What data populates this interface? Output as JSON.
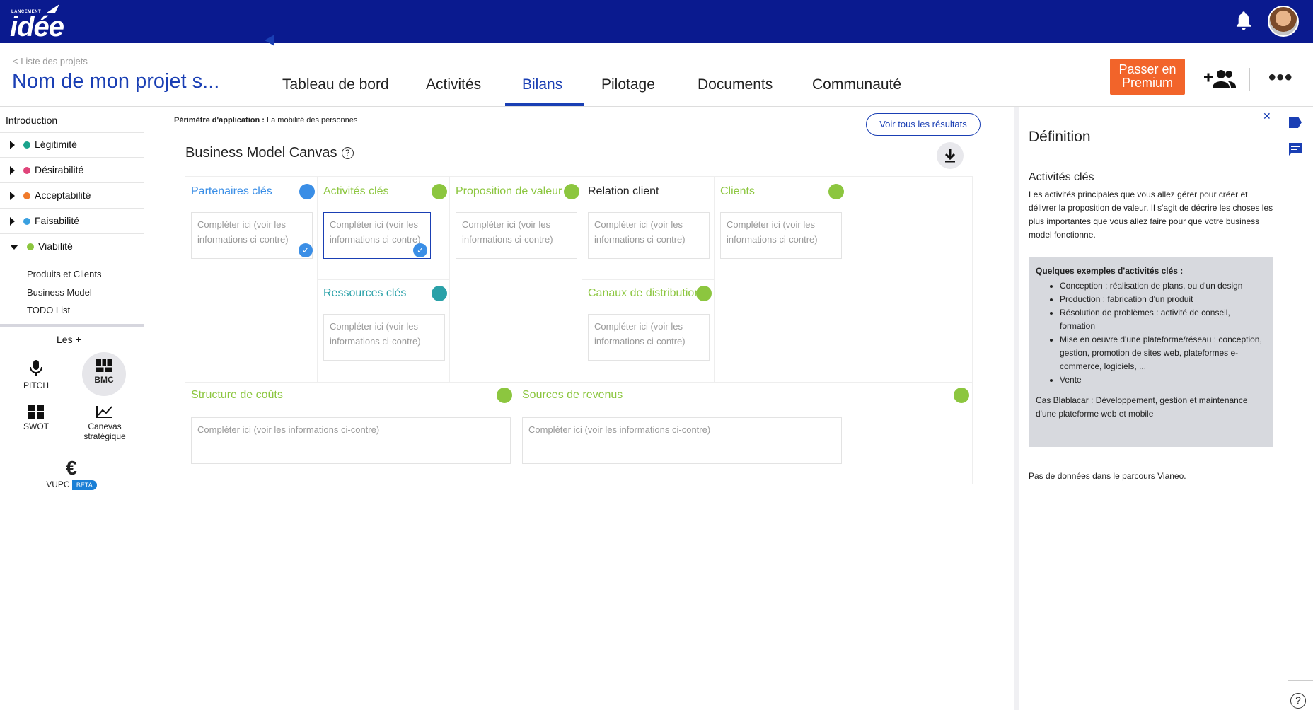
{
  "app": {
    "logo_small": "LANCEMENT",
    "logo_big": "idée"
  },
  "header": {
    "breadcrumb": "< Liste des projets",
    "project_title": "Nom de mon projet s...",
    "tabs": [
      {
        "label": "Tableau de bord"
      },
      {
        "label": "Activités"
      },
      {
        "label": "Bilans"
      },
      {
        "label": "Pilotage"
      },
      {
        "label": "Documents"
      },
      {
        "label": "Communauté"
      }
    ],
    "active_tab": "Bilans",
    "premium_label": "Passer en Premium"
  },
  "sidebar": {
    "intro": "Introduction",
    "items": [
      {
        "label": "Légitimité",
        "color": "#1aa38c"
      },
      {
        "label": "Désirabilité",
        "color": "#e0447a"
      },
      {
        "label": "Acceptabilité",
        "color": "#f07a2a"
      },
      {
        "label": "Faisabilité",
        "color": "#3aa0e0"
      },
      {
        "label": "Viabilité",
        "color": "#8cc63f"
      }
    ],
    "subitems": [
      "Produits et Clients",
      "Business Model",
      "TODO List"
    ],
    "les_plus": "Les +",
    "tools": [
      {
        "label": "PITCH",
        "icon": "microphone-icon"
      },
      {
        "label": "BMC",
        "icon": "bmc-grid-icon"
      },
      {
        "label": "SWOT",
        "icon": "swot-grid-icon"
      },
      {
        "label": "Canevas stratégique",
        "icon": "chart-line-icon"
      },
      {
        "label": "VUPC",
        "icon": "euro-icon",
        "badge": "BETA"
      }
    ]
  },
  "main": {
    "perimetre_label": "Périmètre d'application :",
    "perimetre_value": "La mobilité des personnes",
    "voir_button": "Voir tous les résultats",
    "bmc_title": "Business Model Canvas",
    "placeholder_short": "Compléter ici (voir les informations ci-contre)",
    "placeholder_long": "Compléter ici (voir les informations ci-contre)",
    "cells": {
      "partenaires": "Partenaires clés",
      "activites": "Activités clés",
      "ressources": "Ressources clés",
      "proposition": "Proposition de valeur",
      "relation": "Relation client",
      "canaux": "Canaux de distribution",
      "clients": "Clients",
      "couts": "Structure de coûts",
      "revenus": "Sources de revenus"
    },
    "colors": {
      "blue": "#3a8ee6",
      "green": "#8cc63f",
      "teal": "#2aa1a8",
      "dark": "#222222"
    }
  },
  "right_panel": {
    "title": "Définition",
    "subtitle": "Activités clés",
    "text": "Les activités principales que vous allez gérer pour créer et délivrer la proposition de valeur. Il s'agit de décrire les choses les plus importantes que vous allez faire pour que votre business model fonctionne.",
    "examples_title": "Quelques exemples d'activités clés :",
    "examples": [
      "Conception : réalisation de plans, ou d'un design",
      "Production : fabrication d'un produit",
      "Résolution de problèmes : activité de conseil, formation",
      "Mise en oeuvre d'une plateforme/réseau : conception, gestion, promotion de sites web, plateformes e-commerce, logiciels, ...",
      "Vente"
    ],
    "examples_foot": "Cas Blablacar : Développement, gestion et maintenance d'une plateforme web et mobile",
    "nodata": "Pas de données dans le parcours Vianeo."
  }
}
